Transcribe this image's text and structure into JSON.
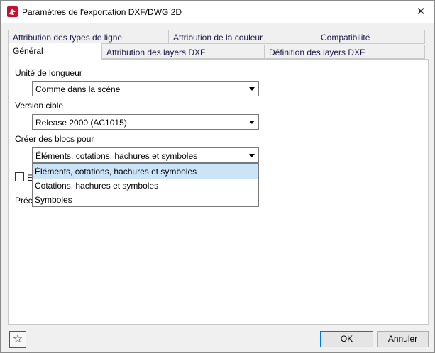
{
  "window": {
    "title": "Paramètres de l'exportation DXF/DWG 2D",
    "close_symbol": "✕"
  },
  "tabs": {
    "row1": [
      "Attribution des types de ligne",
      "Attribution de la couleur",
      "Compatibilité"
    ],
    "row2": [
      "Général",
      "Attribution des layers DXF",
      "Définition des layers DXF"
    ],
    "active": "Général"
  },
  "general": {
    "length_unit_label": "Unité de longueur",
    "length_unit_value": "Comme dans la scène",
    "target_version_label": "Version cible",
    "target_version_value": "Release 2000 (AC1015)",
    "create_blocks_label": "Créer des blocs pour",
    "create_blocks_value": "Éléments, cotations, hachures et symboles",
    "create_blocks_options": [
      "Éléments, cotations, hachures et symboles",
      "Cotations, hachures et symboles",
      "Symboles"
    ],
    "checkbox_partial_label": "E",
    "precision_partial_label": "Préc"
  },
  "footer": {
    "favorite_symbol": "☆",
    "ok_label": "OK",
    "cancel_label": "Annuler"
  },
  "colors": {
    "selection": "#cce4f7",
    "panel": "#ffffff",
    "window_bg": "#f0f0f0",
    "accent": "#0078d7"
  }
}
